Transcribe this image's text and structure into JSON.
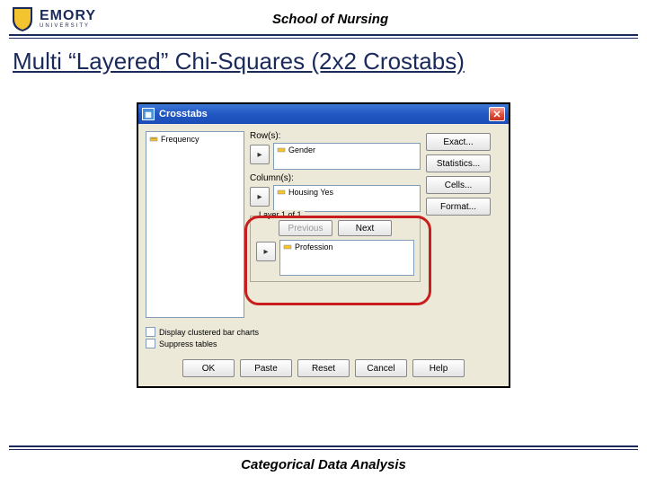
{
  "header": {
    "logo_main": "EMORY",
    "logo_sub": "UNIVERSITY",
    "dept": "School of Nursing"
  },
  "slide": {
    "title": "Multi “Layered” Chi-Squares (2x2 Crostabs)"
  },
  "dialog": {
    "title": "Crosstabs",
    "source_items": [
      "Frequency"
    ],
    "rows_label": "Row(s):",
    "rows_value": "Gender",
    "cols_label": "Column(s):",
    "cols_value": "Housing Yes",
    "layer_title": "Layer 1 of 1",
    "prev_label": "Previous",
    "next_label": "Next",
    "layer_value": "Profession",
    "side_buttons": [
      "Exact...",
      "Statistics...",
      "Cells...",
      "Format..."
    ],
    "chk1": "Display clustered bar charts",
    "chk2": "Suppress tables",
    "buttons": [
      "OK",
      "Paste",
      "Reset",
      "Cancel",
      "Help"
    ]
  },
  "footer": {
    "text": "Categorical Data Analysis"
  }
}
